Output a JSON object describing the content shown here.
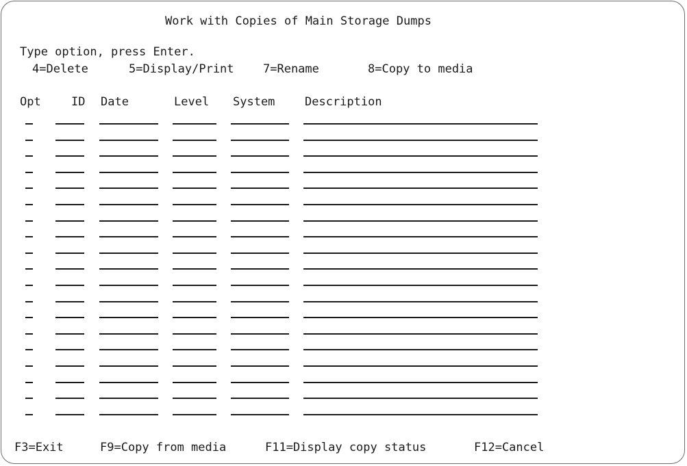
{
  "screen": {
    "title": "Work with Copies of Main Storage Dumps",
    "instruction": "Type option, press Enter."
  },
  "options": [
    "4=Delete",
    "5=Display/Print",
    "7=Rename",
    "8=Copy to media"
  ],
  "columns": [
    "Opt",
    "ID",
    "Date",
    "Level",
    "System",
    "Description"
  ],
  "rows": [
    {
      "opt": "",
      "id": "",
      "date": "",
      "level": "",
      "system": "",
      "description": ""
    },
    {
      "opt": "",
      "id": "",
      "date": "",
      "level": "",
      "system": "",
      "description": ""
    },
    {
      "opt": "",
      "id": "",
      "date": "",
      "level": "",
      "system": "",
      "description": ""
    },
    {
      "opt": "",
      "id": "",
      "date": "",
      "level": "",
      "system": "",
      "description": ""
    },
    {
      "opt": "",
      "id": "",
      "date": "",
      "level": "",
      "system": "",
      "description": ""
    },
    {
      "opt": "",
      "id": "",
      "date": "",
      "level": "",
      "system": "",
      "description": ""
    },
    {
      "opt": "",
      "id": "",
      "date": "",
      "level": "",
      "system": "",
      "description": ""
    },
    {
      "opt": "",
      "id": "",
      "date": "",
      "level": "",
      "system": "",
      "description": ""
    },
    {
      "opt": "",
      "id": "",
      "date": "",
      "level": "",
      "system": "",
      "description": ""
    },
    {
      "opt": "",
      "id": "",
      "date": "",
      "level": "",
      "system": "",
      "description": ""
    },
    {
      "opt": "",
      "id": "",
      "date": "",
      "level": "",
      "system": "",
      "description": ""
    },
    {
      "opt": "",
      "id": "",
      "date": "",
      "level": "",
      "system": "",
      "description": ""
    },
    {
      "opt": "",
      "id": "",
      "date": "",
      "level": "",
      "system": "",
      "description": ""
    },
    {
      "opt": "",
      "id": "",
      "date": "",
      "level": "",
      "system": "",
      "description": ""
    },
    {
      "opt": "",
      "id": "",
      "date": "",
      "level": "",
      "system": "",
      "description": ""
    },
    {
      "opt": "",
      "id": "",
      "date": "",
      "level": "",
      "system": "",
      "description": ""
    },
    {
      "opt": "",
      "id": "",
      "date": "",
      "level": "",
      "system": "",
      "description": ""
    },
    {
      "opt": "",
      "id": "",
      "date": "",
      "level": "",
      "system": "",
      "description": ""
    },
    {
      "opt": "",
      "id": "",
      "date": "",
      "level": "",
      "system": "",
      "description": ""
    }
  ],
  "function_keys": [
    "F3=Exit",
    "F9=Copy from media",
    "F11=Display copy status",
    "F12=Cancel"
  ]
}
